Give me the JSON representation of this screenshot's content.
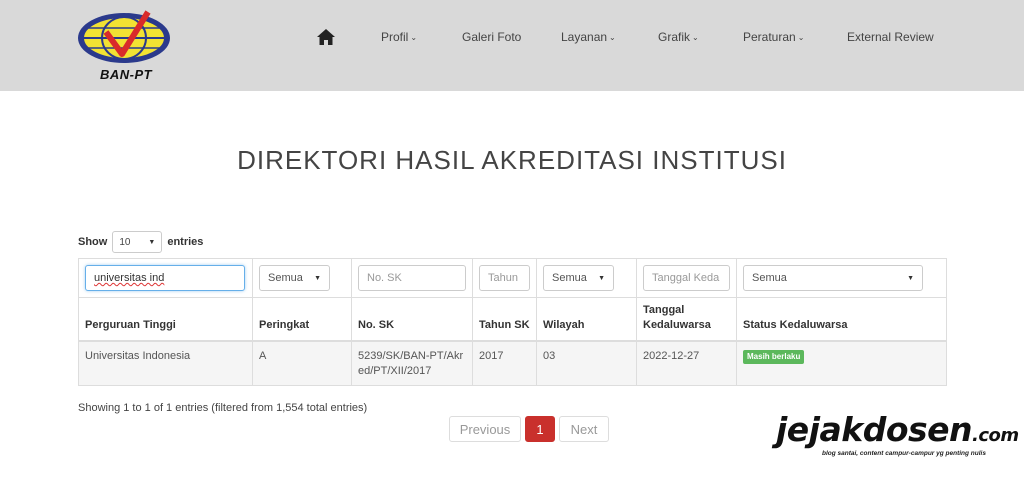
{
  "brand": {
    "logo_text": "BAN-PT"
  },
  "nav": {
    "home_icon": "home-icon",
    "items": [
      {
        "label": "Profil",
        "dropdown": true
      },
      {
        "label": "Galeri Foto",
        "dropdown": false
      },
      {
        "label": "Layanan",
        "dropdown": true
      },
      {
        "label": "Grafik",
        "dropdown": true
      },
      {
        "label": "Peraturan",
        "dropdown": true
      },
      {
        "label": "External Review",
        "dropdown": false
      }
    ]
  },
  "page": {
    "title": "DIREKTORI HASIL AKREDITASI INSTITUSI"
  },
  "length": {
    "show_label": "Show",
    "value": "10",
    "entries_label": "entries"
  },
  "filters": {
    "search_value": "universitas ind",
    "peringkat": "Semua",
    "no_sk_placeholder": "No. SK",
    "tahun_placeholder": "Tahun",
    "wilayah": "Semua",
    "tanggal_placeholder": "Tanggal Keda",
    "status": "Semua"
  },
  "columns": [
    "Perguruan Tinggi",
    "Peringkat",
    "No. SK",
    "Tahun SK",
    "Wilayah",
    "Tanggal Kedaluwarsa",
    "Status Kedaluwarsa"
  ],
  "rows": [
    {
      "perguruan_tinggi": "Universitas Indonesia",
      "peringkat": "A",
      "no_sk": "5239/SK/BAN-PT/Akred/PT/XII/2017",
      "tahun_sk": "2017",
      "wilayah": "03",
      "tanggal": "2022-12-27",
      "status": "Masih berlaku"
    }
  ],
  "info": "Showing 1 to 1 of 1 entries (filtered from 1,554 total entries)",
  "pagination": {
    "previous": "Previous",
    "current": "1",
    "next": "Next"
  },
  "watermark": {
    "main": "jejakdosen",
    "suffix": ".com",
    "tagline": "blog santai, content campur-campur yg penting nulis"
  },
  "colors": {
    "header_bg": "#d9d9d9",
    "badge_green": "#5cb85c",
    "page_active": "#c9302c"
  }
}
